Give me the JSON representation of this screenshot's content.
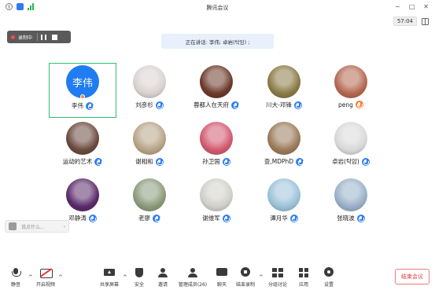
{
  "window": {
    "title": "腾讯会议",
    "timer": "57:04",
    "controls": [
      "−",
      "□",
      "✕"
    ]
  },
  "recording": {
    "label": "录制中"
  },
  "speaker_banner": "正在讲话: 李伟; 卓岩(탁암) ;",
  "participants": [
    {
      "name": "李伟",
      "avatar_text": "李伟",
      "color": "#1f7cf2",
      "active": true,
      "host": true
    },
    {
      "name": "刘彦杉",
      "color": "#d9d2cf"
    },
    {
      "name": "蓉都人在天府",
      "color": "#6b3a2a"
    },
    {
      "name": "川大-邓锋",
      "color": "#8a7a45"
    },
    {
      "name": "peng",
      "color": "#b46850",
      "badge": "orange"
    },
    {
      "name": "运动的艺术",
      "color": "#6a4a3e"
    },
    {
      "name": "谢相和",
      "color": "#b6a487"
    },
    {
      "name": "孙卫国",
      "color": "#d25a6f"
    },
    {
      "name": "查,MDPhD",
      "color": "#9a7a5a"
    },
    {
      "name": "卓岩(탁암)",
      "color": "#d8d8d8"
    },
    {
      "name": "邓静涛",
      "color": "#5a2a6a"
    },
    {
      "name": "老廖",
      "color": "#8a9a7a"
    },
    {
      "name": "谢维军",
      "color": "#d0cfc8"
    },
    {
      "name": "谭月华",
      "color": "#9cc2d8"
    },
    {
      "name": "张晓波",
      "color": "#9ab0c8"
    }
  ],
  "chat": {
    "placeholder": "说点什么..."
  },
  "toolbar": {
    "mute": "静音",
    "video": "开启视频",
    "share": "共享屏幕",
    "security": "安全",
    "invite": "邀请",
    "members": "管理成员(26)",
    "chat": "聊天",
    "record": "结束录制",
    "breakout": "分组讨论",
    "apps": "应用",
    "settings": "设置",
    "end": "结束会议"
  }
}
